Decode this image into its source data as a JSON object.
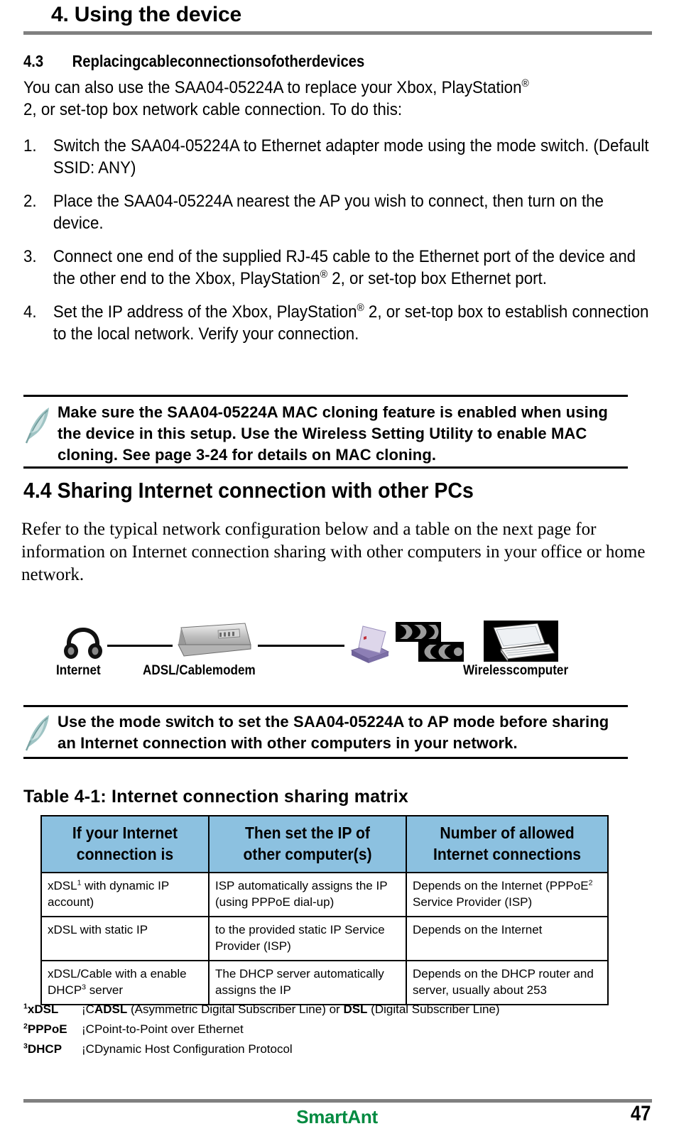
{
  "header": {
    "chapter_title": "4. Using the device"
  },
  "section43": {
    "number": "4.3",
    "title": "Replacingcableconnectionsofotherdevices",
    "intro_part1": "You can also use the SAA04-05224A to replace your Xbox, PlayStation",
    "intro_sup": "®",
    "intro_part2": "2, or set-top box network cable connection. To do this:",
    "steps": [
      {
        "marker": "1.",
        "text": "Switch the SAA04-05224A to Ethernet adapter mode using the mode switch. (Default SSID: ANY)"
      },
      {
        "marker": "2.",
        "text": "Place the SAA04-05224A nearest the AP you wish to connect, then turn on the device."
      },
      {
        "marker": "3.",
        "text_a": "Connect one end of the supplied RJ-45 cable to the Ethernet port of the device and the other end to the Xbox, PlayStation",
        "sup": "®",
        "text_b": " 2, or set-top box Ethernet port."
      },
      {
        "marker": "4.",
        "text_a": "Set the IP address of the Xbox, PlayStation",
        "sup": "®",
        "text_b": " 2, or set-top box to establish connection to the local network. Verify your connection."
      }
    ]
  },
  "note1": {
    "icon": "quill-pen-icon",
    "text": "Make sure the SAA04-05224A MAC cloning feature is enabled when using the device in this setup. Use the Wireless Setting Utility to enable MAC cloning. See page 3-24 for details on MAC cloning."
  },
  "section44": {
    "heading": "4.4  Sharing Internet connection with other PCs",
    "paragraph": "Refer to the typical network configuration below and a table on the next page for information on Internet connection sharing with other computers in your office or home network."
  },
  "diagram": {
    "nodes": [
      {
        "icon": "internet-globe-icon",
        "label": "Internet"
      },
      {
        "icon": "adsl-cable-modem-icon",
        "label": "ADSL/Cablemodem"
      },
      {
        "icon": "wireless-access-point-icon",
        "label": ""
      },
      {
        "icon": "wireless-signal-waves-icon",
        "label": ""
      },
      {
        "icon": "laptop-icon",
        "label": "Wirelesscomputer"
      }
    ]
  },
  "note2": {
    "icon": "quill-pen-icon",
    "text": "Use the mode switch to set the SAA04-05224A to AP mode before sharing an Internet connection with other computers in your network."
  },
  "table": {
    "title": "Table 4-1: Internet connection sharing matrix",
    "header_bg": "#8cc1e0",
    "headers": [
      "If your Internet connection is",
      "Then set the IP of other computer(s)",
      "Number of allowed Internet connections"
    ],
    "header_lines": [
      [
        "If your Internet",
        "connection is"
      ],
      [
        "Then set the IP of",
        "other computer(s)"
      ],
      [
        "Number of allowed",
        "Internet connections"
      ]
    ],
    "rows": [
      {
        "c1_a": "xDSL",
        "c1_sup": "1",
        "c1_b": " with dynamic IP account)",
        "c2": "ISP automatically assigns the IP (using PPPoE dial-up)",
        "c3_a": "Depends on the Internet (PPPoE",
        "c3_sup": "2",
        "c3_b": " Service Provider (ISP)"
      },
      {
        "c1_a": "xDSL with static IP",
        "c1_sup": "",
        "c1_b": "",
        "c2": "to the provided static IP Service Provider (ISP)",
        "c3_a": "Depends on the Internet",
        "c3_sup": "",
        "c3_b": ""
      },
      {
        "c1_a": "xDSL/Cable with a enable DHCP",
        "c1_sup": "3",
        "c1_b": " server",
        "c2": "The DHCP server automatically assigns the IP",
        "c3_a": "Depends on the DHCP router and server, usually about 253",
        "c3_sup": "",
        "c3_b": ""
      }
    ]
  },
  "footnotes": [
    {
      "sup": "1",
      "term": "xDSL",
      "sep": "¡C",
      "strong1": "ADSL",
      "text1": " (Asymmetric Digital Subscriber Line) or ",
      "strong2": "DSL",
      "text2": " (Digital Subscriber Line)"
    },
    {
      "sup": "2",
      "term": "PPPoE",
      "sep": "¡C",
      "strong1": "",
      "text1": "Point-to-Point over Ethernet",
      "strong2": "",
      "text2": ""
    },
    {
      "sup": "3",
      "term": "DHCP",
      "sep": "¡C",
      "strong1": "",
      "text1": "Dynamic Host Configuration Protocol",
      "strong2": "",
      "text2": ""
    }
  ],
  "footer": {
    "brand": "SmartAnt",
    "brand_color": "#008a40",
    "page_number": "47",
    "rule_color": "#808080"
  }
}
